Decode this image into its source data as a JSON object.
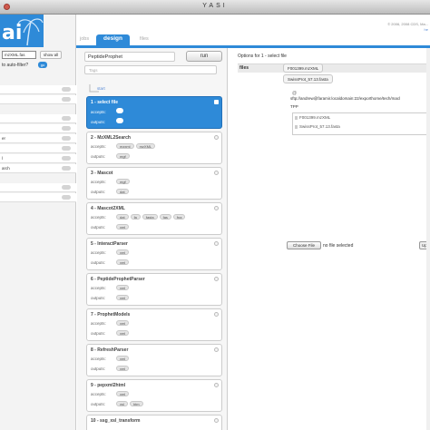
{
  "window": {
    "title": "YASI"
  },
  "header": {
    "copyright": "© 2006, 2008 CDS, Ma...",
    "help": "he",
    "tabs": [
      {
        "label": "jobs",
        "active": false
      },
      {
        "label": "design",
        "active": true
      },
      {
        "label": "files",
        "active": false
      }
    ]
  },
  "left": {
    "logo": "ai",
    "filter_value": "mzXML.fas",
    "show_all": "show all",
    "autofilter": "to auto-filter?",
    "go": "go",
    "items": [
      "",
      "",
      "",
      "",
      "er",
      "",
      "l",
      "arch",
      "",
      ""
    ]
  },
  "middle": {
    "pipeline_name": "PeptideProphet",
    "run_label": "run",
    "tags_placeholder": "Tags",
    "start_label": "start",
    "steps": [
      {
        "title": "1 - select file",
        "accepts": [],
        "outputs": [],
        "selected": true
      },
      {
        "title": "2 - MzXML2Search",
        "accepts": [
          "mzxml",
          "mzXML"
        ],
        "outputs": [
          "mgf"
        ],
        "selected": false
      },
      {
        "title": "3 - Mascot",
        "accepts": [
          "mgf"
        ],
        "outputs": [
          "dat"
        ],
        "selected": false
      },
      {
        "title": "4 - Mascot2XML",
        "accepts": [
          "dat",
          "fa",
          "fasta",
          "fas",
          "fna"
        ],
        "outputs": [
          "xml"
        ],
        "selected": false
      },
      {
        "title": "5 - InteractParser",
        "accepts": [
          "xml"
        ],
        "outputs": [
          "xml"
        ],
        "selected": false
      },
      {
        "title": "6 - PeptideProphetParser",
        "accepts": [
          "xml"
        ],
        "outputs": [
          "xml"
        ],
        "selected": false
      },
      {
        "title": "7 - ProphetModels",
        "accepts": [
          "xml"
        ],
        "outputs": [
          "xml"
        ],
        "selected": false
      },
      {
        "title": "8 - RefreshParser",
        "accepts": [
          "xml"
        ],
        "outputs": [
          "xml"
        ],
        "selected": false
      },
      {
        "title": "9 - pepxml2html",
        "accepts": [
          "xml"
        ],
        "outputs": [
          "xsl",
          "htm"
        ],
        "selected": false
      },
      {
        "title": "10 - ssg_xsl_transform",
        "accepts": [],
        "outputs": [],
        "selected": false
      }
    ],
    "accepts_label": "accepts:",
    "outputs_label": "outputs:"
  },
  "right": {
    "options_title": "Options for 1 - select file",
    "files_label": "files",
    "file_chips": [
      "F001399.mzXML",
      "SwissProt_57.13.fasta"
    ],
    "sftp_path": "sftp://andrew@faramir.localdomain:22/exporthome/tech/macl",
    "tpp": "TPP",
    "file_list": [
      "F001399.mzXML",
      "SwissProt_57.13.fasta"
    ],
    "choose_file": "Choose File",
    "no_file": "no file selected",
    "upload": "Up"
  }
}
